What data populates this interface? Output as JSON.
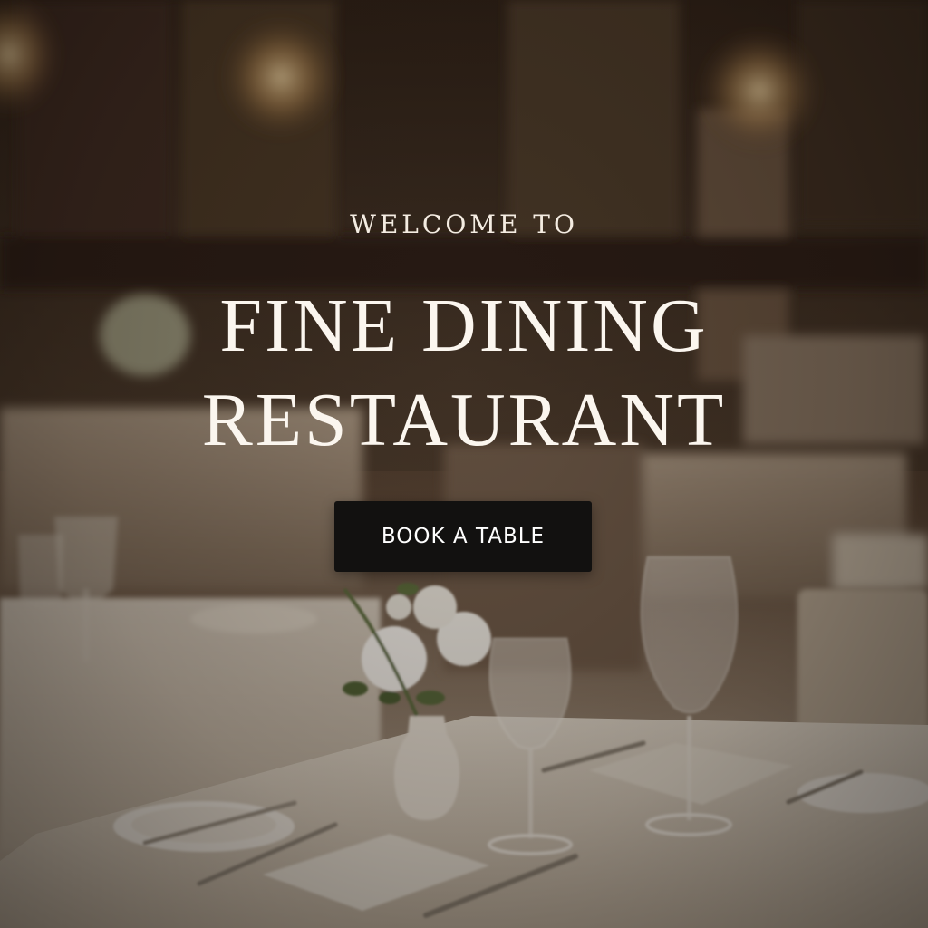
{
  "hero": {
    "eyebrow": "WELCOME TO",
    "title_line1": "FINE DINING",
    "title_line2": "RESTAURANT",
    "cta_label": "BOOK A TABLE"
  },
  "colors": {
    "text": "#fbf6ef",
    "button_bg": "#121110",
    "button_text": "#ffffff",
    "ambient": "#3a2a1e"
  }
}
